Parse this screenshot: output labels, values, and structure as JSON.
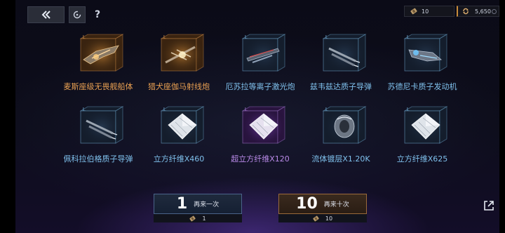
{
  "topbar": {
    "help_label": "?",
    "ticket_count": "10",
    "coin_count": "5,650"
  },
  "items": [
    {
      "name": "麦斯座级无畏舰船体",
      "tier": "orange",
      "art": "ship-hull"
    },
    {
      "name": "猎犬座伽马射线炮",
      "tier": "orange",
      "art": "gamma-cannon"
    },
    {
      "name": "厄苏拉等离子激光炮",
      "tier": "blue",
      "art": "plasma-laser"
    },
    {
      "name": "兹韦兹达质子导弹",
      "tier": "blue",
      "art": "proton-missile"
    },
    {
      "name": "苏德尼卡质子发动机",
      "tier": "blue",
      "art": "proton-engine"
    },
    {
      "name": "佩科拉伯格质子导弹",
      "tier": "blue",
      "art": "proton-missile"
    },
    {
      "name": "立方纤维X460",
      "tier": "blue",
      "art": "cube-fiber"
    },
    {
      "name": "超立方纤维X120",
      "tier": "purple",
      "art": "hyper-cube-fiber"
    },
    {
      "name": "流体镀层X1.20K",
      "tier": "blue",
      "art": "fluid-coating"
    },
    {
      "name": "立方纤维X625",
      "tier": "blue",
      "art": "cube-fiber"
    }
  ],
  "tier_marker": "L",
  "pull_once": {
    "count": "1",
    "label": "再来一次",
    "cost": "1"
  },
  "pull_ten": {
    "count": "10",
    "label": "再来十次",
    "cost": "10"
  },
  "colors": {
    "orange": "#e9a052",
    "blue": "#7fc0ec",
    "purple": "#b98ae8"
  }
}
